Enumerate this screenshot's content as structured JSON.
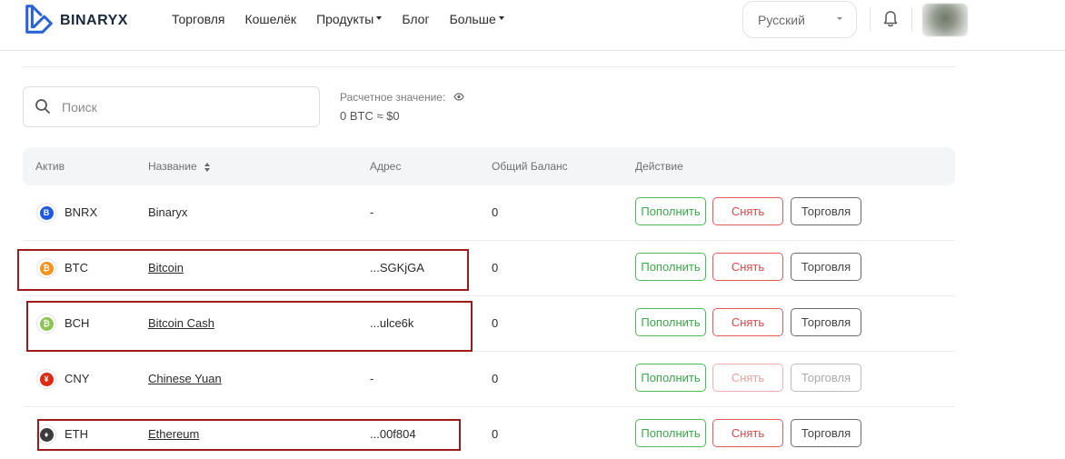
{
  "brand": {
    "name": "BINARYX"
  },
  "nav": [
    {
      "label": "Торговля",
      "has_dropdown": false
    },
    {
      "label": "Кошелёк",
      "has_dropdown": false
    },
    {
      "label": "Продукты",
      "has_dropdown": true
    },
    {
      "label": "Блог",
      "has_dropdown": false
    },
    {
      "label": "Больше",
      "has_dropdown": true
    }
  ],
  "header": {
    "language": "Русский",
    "notifications_icon": "bell-icon",
    "avatar_icon": "user-avatar"
  },
  "search": {
    "placeholder": "Поиск",
    "value": "",
    "icon": "search-icon"
  },
  "estimate": {
    "label": "Расчетное значение:",
    "icon": "eye-icon",
    "value": "0 BTC  ≈ $0"
  },
  "table": {
    "headers": {
      "asset": "Актив",
      "name": "Название",
      "address": "Адрес",
      "balance": "Общий Баланс",
      "action": "Действие"
    },
    "sort_icon": "sort-icon",
    "actions": {
      "deposit": "Пополнить",
      "withdraw": "Снять",
      "trade": "Торговля"
    },
    "rows": [
      {
        "symbol": "BNRX",
        "name": "Binaryx",
        "address": "-",
        "balance": "0",
        "icon_color": "#1e5ae0",
        "icon_glyph": "B",
        "link": false,
        "enabled": true
      },
      {
        "symbol": "BTC",
        "name": "Bitcoin",
        "address": "...SGKjGA",
        "balance": "0",
        "icon_color": "#f7931a",
        "icon_glyph": "₿",
        "link": true,
        "enabled": true
      },
      {
        "symbol": "BCH",
        "name": "Bitcoin Cash",
        "address": "...ulce6k",
        "balance": "0",
        "icon_color": "#8dc351",
        "icon_glyph": "₿",
        "link": true,
        "enabled": true
      },
      {
        "symbol": "CNY",
        "name": "Chinese Yuan",
        "address": "-",
        "balance": "0",
        "icon_color": "#de2910",
        "icon_glyph": "¥",
        "link": true,
        "enabled": false
      },
      {
        "symbol": "ETH",
        "name": "Ethereum",
        "address": "...00f804",
        "balance": "0",
        "icon_color": "#3c3c3d",
        "icon_glyph": "♦",
        "link": true,
        "enabled": true
      }
    ]
  },
  "colors": {
    "highlight_box": "#9e1b1b",
    "deposit": "#3aa84a",
    "withdraw": "#d94848",
    "header_bg": "#f4f5f6"
  }
}
